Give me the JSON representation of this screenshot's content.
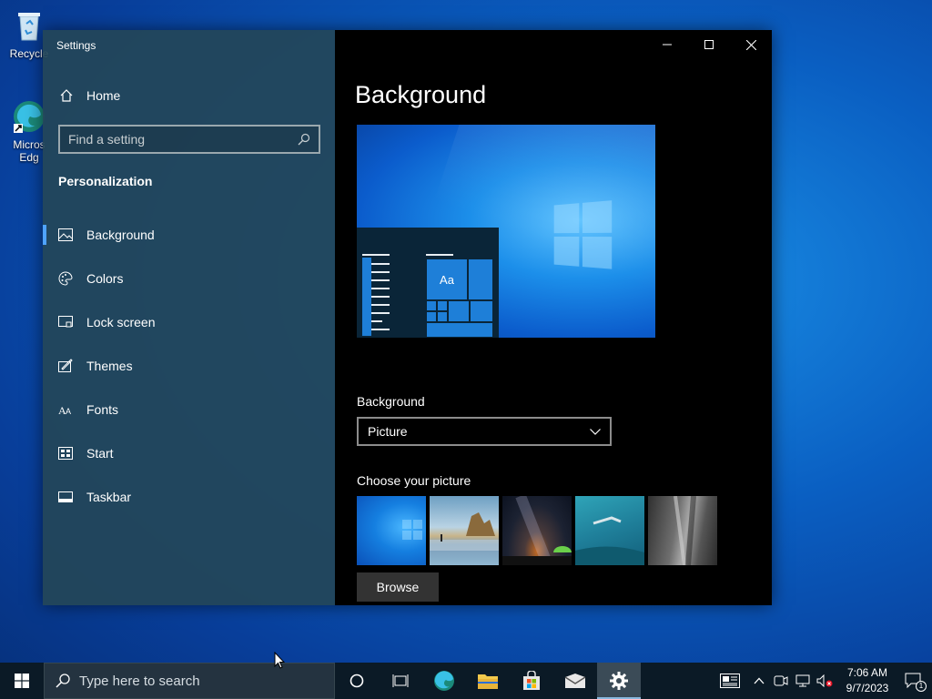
{
  "desktop": {
    "icons": [
      {
        "label": "Recycle"
      },
      {
        "label": "Micros Edg"
      }
    ]
  },
  "window": {
    "title": "Settings",
    "controls": {
      "minimize": "minimize-icon",
      "maximize": "maximize-icon",
      "close": "close-icon"
    }
  },
  "sidebar": {
    "home_label": "Home",
    "search_placeholder": "Find a setting",
    "section_title": "Personalization",
    "items": [
      {
        "label": "Background",
        "icon": "picture-icon",
        "active": true
      },
      {
        "label": "Colors",
        "icon": "palette-icon"
      },
      {
        "label": "Lock screen",
        "icon": "lock-screen-icon"
      },
      {
        "label": "Themes",
        "icon": "themes-icon"
      },
      {
        "label": "Fonts",
        "icon": "fonts-icon"
      },
      {
        "label": "Start",
        "icon": "start-icon"
      },
      {
        "label": "Taskbar",
        "icon": "taskbar-icon"
      }
    ]
  },
  "main": {
    "page_title": "Background",
    "preview_tile_text": "Aa",
    "background_label": "Background",
    "background_value": "Picture",
    "choose_label": "Choose your picture",
    "browse_label": "Browse"
  },
  "taskbar": {
    "search_placeholder": "Type here to search",
    "time": "7:06 AM",
    "date": "9/7/2023",
    "notification_count": "1"
  },
  "colors": {
    "accent": "#4fa3ff",
    "sidebar_bg": "#234658",
    "content_bg": "#000000",
    "taskbar_bg": "#0b1a26"
  }
}
